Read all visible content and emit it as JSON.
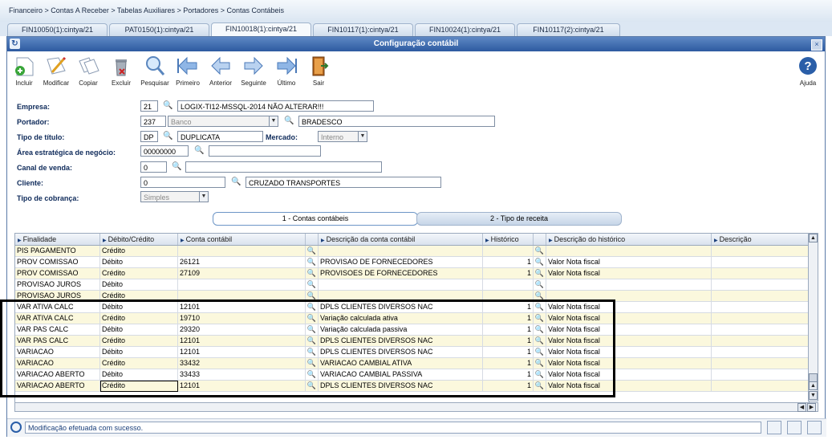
{
  "breadcrumb": "Financeiro > Contas A Receber > Tabelas Auxiliares > Portadores > Contas Contábeis",
  "tabs": [
    {
      "label": "FIN10050(1):cintya/21"
    },
    {
      "label": "PAT0150(1):cintya/21"
    },
    {
      "label": "FIN10018(1):cintya/21",
      "active": true
    },
    {
      "label": "FIN10117(1):cintya/21"
    },
    {
      "label": "FIN10024(1):cintya/21"
    },
    {
      "label": "FIN10117(2):cintya/21"
    }
  ],
  "window": {
    "title": "Configuração contábil"
  },
  "toolbar": {
    "incluir": "Incluir",
    "modificar": "Modificar",
    "copiar": "Copiar",
    "excluir": "Excluir",
    "pesquisar": "Pesquisar",
    "primeiro": "Primeiro",
    "anterior": "Anterior",
    "seguinte": "Seguinte",
    "ultimo": "Último",
    "sair": "Sair",
    "ajuda": "Ajuda"
  },
  "form": {
    "empresa": {
      "label": "Empresa:",
      "code": "21",
      "desc": "LOGIX-TI12-MSSQL-2014 NÃO ALTERAR!!!"
    },
    "portador": {
      "label": "Portador:",
      "code": "237",
      "type": "Banco",
      "desc": "BRADESCO"
    },
    "tipo_titulo": {
      "label": "Tipo de título:",
      "code": "DP",
      "desc": "DUPLICATA"
    },
    "mercado": {
      "label": "Mercado:",
      "value": "Interno"
    },
    "area": {
      "label": "Área estratégica de negócio:",
      "code": "00000000",
      "desc": ""
    },
    "canal": {
      "label": "Canal de venda:",
      "code": "0",
      "desc": ""
    },
    "cliente": {
      "label": "Cliente:",
      "code": "0",
      "desc": "CRUZADO TRANSPORTES"
    },
    "cobranca": {
      "label": "Tipo de cobrança:",
      "value": "Simples"
    }
  },
  "subtabs": {
    "t1": "1 - Contas contábeis",
    "t2": "2 - Tipo de receita"
  },
  "grid": {
    "columns": [
      "Finalidade",
      "Débito/Crédito",
      "Conta contábil",
      "Descrição da conta contábil",
      "Histórico",
      "Descrição do histórico",
      "Descrição"
    ],
    "rows": [
      {
        "fin": "PIS PAGAMENTO",
        "dc": "Crédito",
        "conta": "",
        "desc": "",
        "hist": "",
        "hdesc": ""
      },
      {
        "fin": "PROV COMISSAO",
        "dc": "Débito",
        "conta": "26121",
        "desc": "PROVISAO DE FORNECEDORES",
        "hist": "1",
        "hdesc": "Valor Nota fiscal"
      },
      {
        "fin": "PROV COMISSAO",
        "dc": "Crédito",
        "conta": "27109",
        "desc": "PROVISOES DE FORNECEDORES",
        "hist": "1",
        "hdesc": "Valor Nota fiscal"
      },
      {
        "fin": "PROVISAO JUROS",
        "dc": "Débito",
        "conta": "",
        "desc": "",
        "hist": "",
        "hdesc": ""
      },
      {
        "fin": "PROVISAO JUROS",
        "dc": "Crédito",
        "conta": "",
        "desc": "",
        "hist": "",
        "hdesc": ""
      },
      {
        "fin": "VAR ATIVA CALC",
        "dc": "Débito",
        "conta": "12101",
        "desc": "DPLS CLIENTES DIVERSOS NAC",
        "hist": "1",
        "hdesc": "Valor Nota fiscal"
      },
      {
        "fin": "VAR ATIVA CALC",
        "dc": "Crédito",
        "conta": "19710",
        "desc": "Variação calculada ativa",
        "hist": "1",
        "hdesc": "Valor Nota fiscal"
      },
      {
        "fin": "VAR PAS CALC",
        "dc": "Débito",
        "conta": "29320",
        "desc": "Variação calculada passiva",
        "hist": "1",
        "hdesc": "Valor Nota fiscal"
      },
      {
        "fin": "VAR PAS CALC",
        "dc": "Crédito",
        "conta": "12101",
        "desc": "DPLS CLIENTES DIVERSOS NAC",
        "hist": "1",
        "hdesc": "Valor Nota fiscal"
      },
      {
        "fin": "VARIACAO",
        "dc": "Débito",
        "conta": "12101",
        "desc": "DPLS CLIENTES DIVERSOS NAC",
        "hist": "1",
        "hdesc": "Valor Nota fiscal"
      },
      {
        "fin": "VARIACAO",
        "dc": "Crédito",
        "conta": "33432",
        "desc": "VARIACAO CAMBIAL ATIVA",
        "hist": "1",
        "hdesc": "Valor Nota fiscal"
      },
      {
        "fin": "VARIACAO ABERTO",
        "dc": "Débito",
        "conta": "33433",
        "desc": "VARIACAO CAMBIAL PASSIVA",
        "hist": "1",
        "hdesc": "Valor Nota fiscal"
      },
      {
        "fin": "VARIACAO ABERTO",
        "dc": "Crédito",
        "conta": "12101",
        "desc": "DPLS CLIENTES DIVERSOS NAC",
        "hist": "1",
        "hdesc": "Valor Nota fiscal"
      }
    ]
  },
  "status": {
    "message": "Modificação efetuada com sucesso."
  }
}
